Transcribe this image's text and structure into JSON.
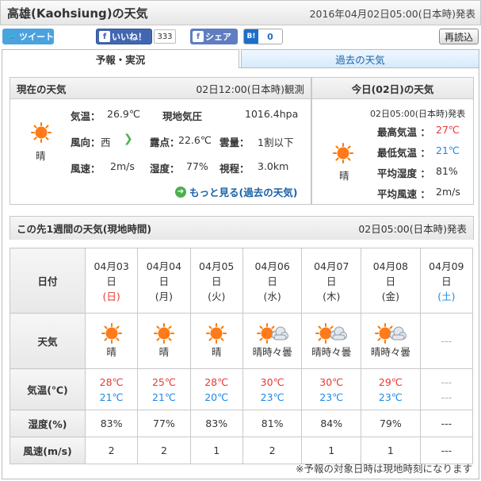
{
  "header": {
    "title": "高雄(Kaohsiung)の天気",
    "issued": "2016年04月02日05:00(日本時)発表"
  },
  "share": {
    "tweet": "ツイート",
    "like": "いいね！",
    "like_count": "333",
    "share": "シェア",
    "hatena_icon": "B!",
    "hatena_count": "0",
    "reload": "再読込"
  },
  "tabs": {
    "forecast": "予報・実況",
    "past": "過去の天気"
  },
  "current": {
    "title": "現在の天気",
    "observed": "02日12:00(日本時)観測",
    "weather": "晴",
    "temp_label": "気温：",
    "temp": "26.9℃",
    "pressure_label": "現地気圧",
    "pressure": "1016.4hpa",
    "wind_dir_label": "風向：",
    "wind_dir": "西",
    "dew_label": "露点：",
    "dew": "22.6℃",
    "cloud_label": "雲量：",
    "cloud": "1割以下",
    "wind_speed_label": "風速：",
    "wind_speed": "2m/s",
    "humidity_label": "湿度：",
    "humidity": "77%",
    "visibility_label": "視程：",
    "visibility": "3.0km",
    "more": "もっと見る(過去の天気)"
  },
  "today": {
    "title": "今日(02日)の天気",
    "issued": "02日05:00(日本時)発表",
    "weather": "晴",
    "max_label": "最高気温 ：",
    "max": "27℃",
    "min_label": "最低気温 ：",
    "min": "21℃",
    "humidity_label": "平均湿度 ：",
    "humidity": "81%",
    "wind_label": "平均風速 ：",
    "wind": "2m/s"
  },
  "week": {
    "title": "この先1週間の天気(現地時間)",
    "issued": "02日05:00(日本時)発表",
    "row_labels": {
      "date": "日付",
      "weather": "天気",
      "temp": "気温(℃)",
      "humidity": "湿度(%)",
      "wind": "風速(m/s)"
    },
    "days": [
      {
        "date": "04月03",
        "day_suffix": "日",
        "weekday": "(日)",
        "wd_color": "#e53935",
        "weather": "晴",
        "icon": "sun-icon",
        "max": "28℃",
        "min": "21℃",
        "humidity": "83%",
        "wind": "2"
      },
      {
        "date": "04月04",
        "day_suffix": "日",
        "weekday": "(月)",
        "wd_color": "#333333",
        "weather": "晴",
        "icon": "sun-icon",
        "max": "25℃",
        "min": "21℃",
        "humidity": "77%",
        "wind": "2"
      },
      {
        "date": "04月05",
        "day_suffix": "日",
        "weekday": "(火)",
        "wd_color": "#333333",
        "weather": "晴",
        "icon": "sun-icon",
        "max": "28℃",
        "min": "20℃",
        "humidity": "83%",
        "wind": "1"
      },
      {
        "date": "04月06",
        "day_suffix": "日",
        "weekday": "(水)",
        "wd_color": "#333333",
        "weather": "晴時々曇",
        "icon": "sun-cloud-icon",
        "max": "30℃",
        "min": "23℃",
        "humidity": "81%",
        "wind": "2"
      },
      {
        "date": "04月07",
        "day_suffix": "日",
        "weekday": "(木)",
        "wd_color": "#333333",
        "weather": "晴時々曇",
        "icon": "sun-cloud-icon",
        "max": "30℃",
        "min": "23℃",
        "humidity": "84%",
        "wind": "1"
      },
      {
        "date": "04月08",
        "day_suffix": "日",
        "weekday": "(金)",
        "wd_color": "#333333",
        "weather": "晴時々曇",
        "icon": "sun-cloud-icon",
        "max": "29℃",
        "min": "23℃",
        "humidity": "79%",
        "wind": "1"
      },
      {
        "date": "04月09",
        "day_suffix": "日",
        "weekday": "(土)",
        "wd_color": "#1e88e5",
        "weather": "---",
        "icon": "",
        "max": "---",
        "min": "---",
        "humidity": "---",
        "wind": "---"
      }
    ],
    "note": "※予報の対象日時は現地時刻になります"
  }
}
